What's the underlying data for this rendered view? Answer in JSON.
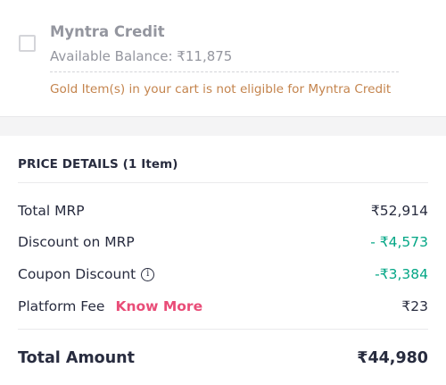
{
  "credit": {
    "title": "Myntra Credit",
    "balance_label": "Available Balance: ₹11,875",
    "warning": "Gold Item(s) in your cart is not eligible for Myntra Credit"
  },
  "price_details": {
    "heading": "PRICE DETAILS (1 Item)",
    "rows": [
      {
        "label": "Total MRP",
        "value": "₹52,914"
      },
      {
        "label": "Discount on MRP",
        "value": "- ₹4,573"
      },
      {
        "label": "Coupon Discount",
        "value": "-₹3,384",
        "icon": "info-icon"
      },
      {
        "label": "Platform Fee",
        "link": "Know More",
        "value": "₹23"
      }
    ],
    "total": {
      "label": "Total Amount",
      "value": "₹44,980"
    }
  },
  "colors": {
    "accent_pink": "#e94d78",
    "discount_green": "#03a685",
    "warning_orange": "#c4844d"
  }
}
